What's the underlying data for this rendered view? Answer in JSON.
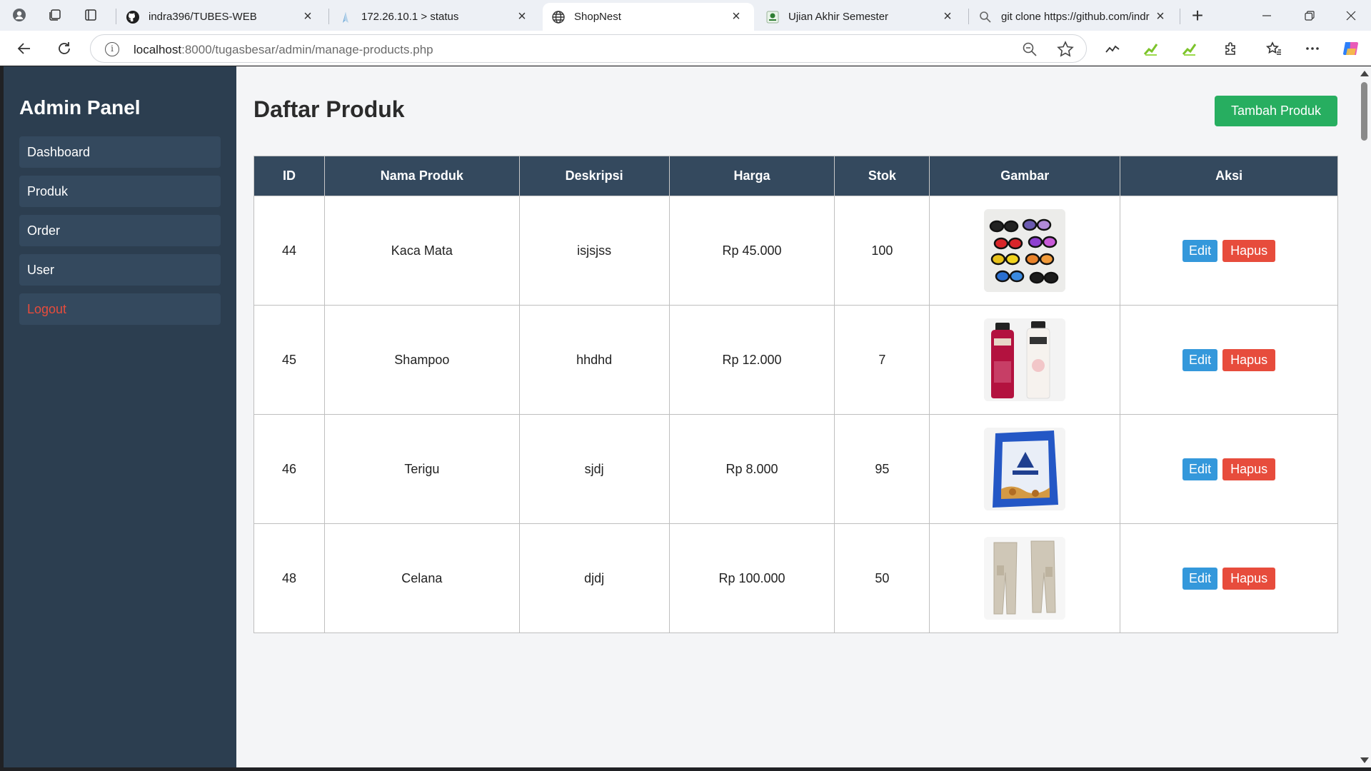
{
  "browser": {
    "tabs": [
      {
        "title": "indra396/TUBES-WEB",
        "favicon": "github-icon"
      },
      {
        "title": "172.26.10.1 > status",
        "favicon": "router-icon"
      },
      {
        "title": "ShopNest",
        "favicon": "globe-icon",
        "active": true
      },
      {
        "title": "Ujian Akhir Semester",
        "favicon": "school-icon"
      },
      {
        "title": "git clone https://github.com/indr",
        "favicon": "search-icon"
      }
    ],
    "url_host": "localhost",
    "url_path": ":8000/tugasbesar/admin/manage-products.php"
  },
  "sidebar": {
    "title": "Admin Panel",
    "items": [
      {
        "label": "Dashboard"
      },
      {
        "label": "Produk"
      },
      {
        "label": "Order"
      },
      {
        "label": "User"
      },
      {
        "label": "Logout"
      }
    ]
  },
  "main": {
    "title": "Daftar Produk",
    "add_button": "Tambah Produk",
    "columns": [
      "ID",
      "Nama Produk",
      "Deskripsi",
      "Harga",
      "Stok",
      "Gambar",
      "Aksi"
    ],
    "rows": [
      {
        "id": "44",
        "name": "Kaca Mata",
        "desc": "isjsjss",
        "price": "Rp 45.000",
        "stock": "100",
        "image": "sunglasses-image",
        "edit": "Edit",
        "delete": "Hapus"
      },
      {
        "id": "45",
        "name": "Shampoo",
        "desc": "hhdhd",
        "price": "Rp 12.000",
        "stock": "7",
        "image": "shampoo-image",
        "edit": "Edit",
        "delete": "Hapus"
      },
      {
        "id": "46",
        "name": "Terigu",
        "desc": "sjdj",
        "price": "Rp 8.000",
        "stock": "95",
        "image": "flour-bag-image",
        "edit": "Edit",
        "delete": "Hapus"
      },
      {
        "id": "48",
        "name": "Celana",
        "desc": "djdj",
        "price": "Rp 100.000",
        "stock": "50",
        "image": "pants-image",
        "edit": "Edit",
        "delete": "Hapus"
      }
    ]
  },
  "colors": {
    "sidebar_bg": "#2c3e50",
    "sidebar_item_bg": "#34495e",
    "table_header_bg": "#34495e",
    "add_button": "#27ae60",
    "edit_button": "#3498db",
    "delete_button": "#e74c3c",
    "logout_text": "#e74c3c"
  }
}
